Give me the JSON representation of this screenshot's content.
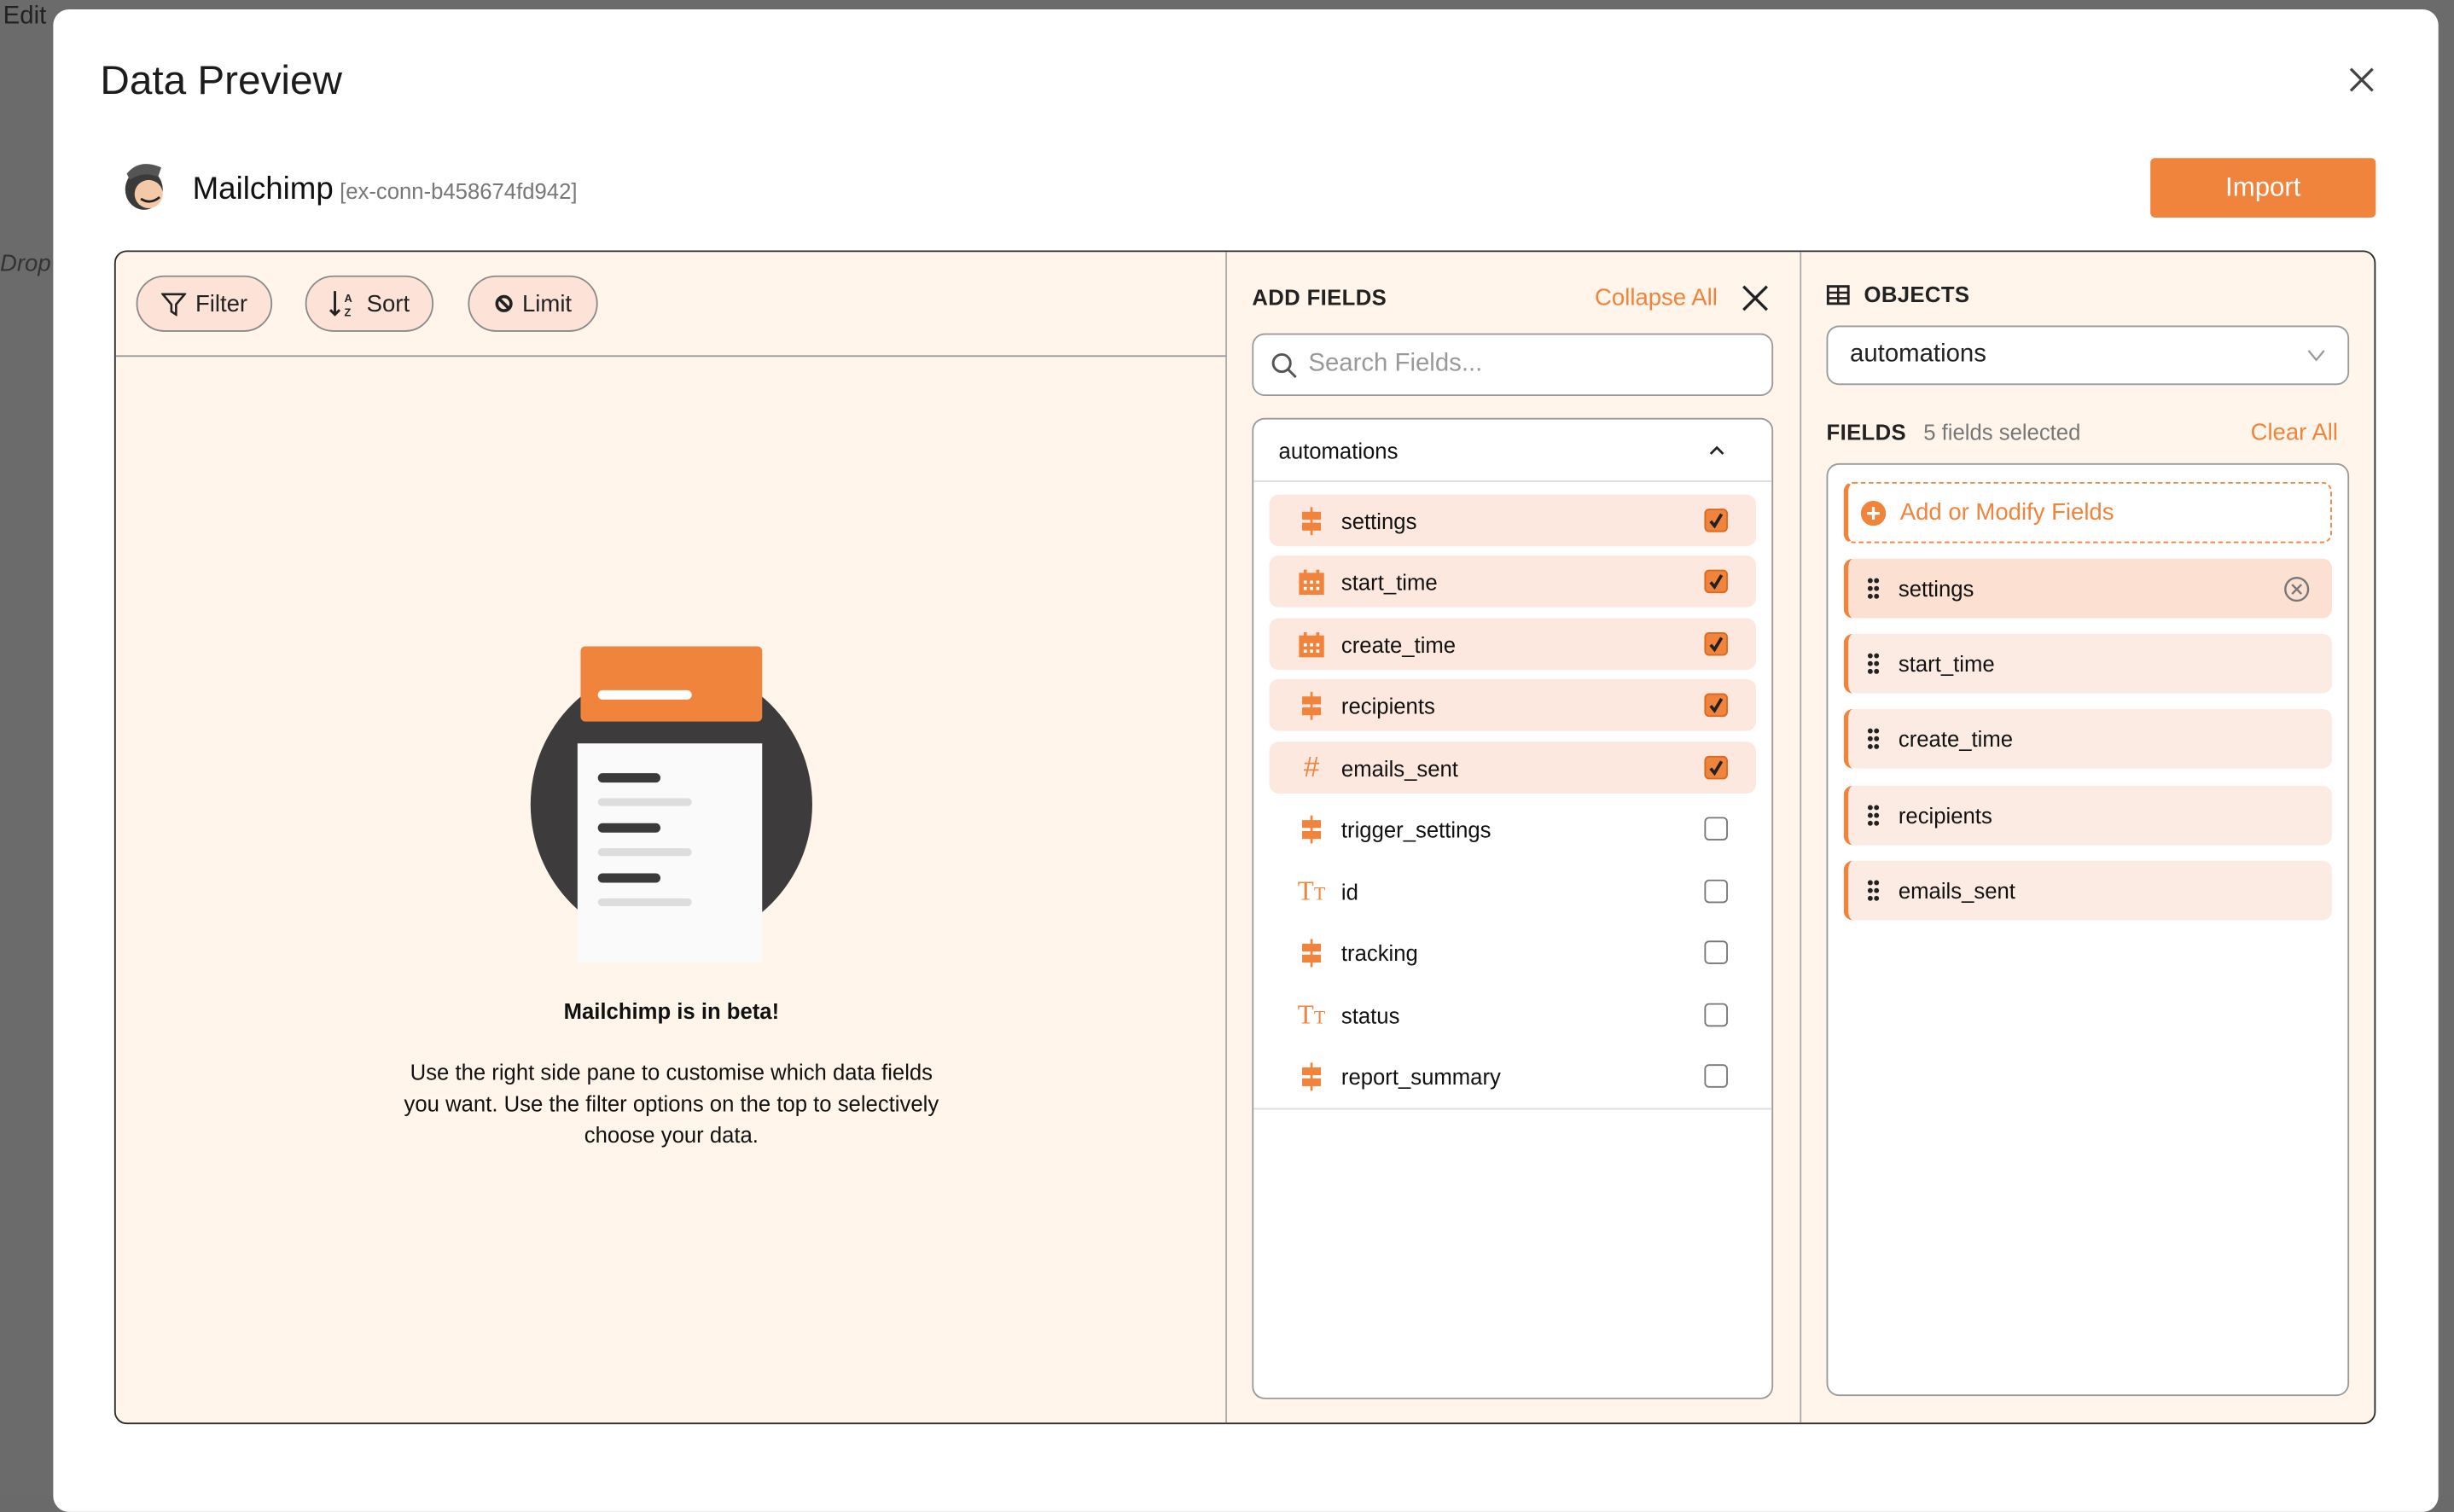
{
  "background": {
    "menu_edit": "Edit",
    "cell_text": "Drop"
  },
  "modal": {
    "title": "Data Preview",
    "connector": {
      "name": "Mailchimp",
      "id": "[ex-conn-b458674fd942]"
    },
    "import_label": "Import",
    "accent": "#f0843c"
  },
  "toolbar": {
    "filter": "Filter",
    "sort": "Sort",
    "limit": "Limit"
  },
  "empty_state": {
    "heading": "Mailchimp is in beta!",
    "lines": [
      "Use the right side pane to customise which data fields",
      "you want. Use the filter options on the top to selectively",
      "choose your data."
    ]
  },
  "add_fields": {
    "title": "ADD FIELDS",
    "collapse_all": "Collapse All",
    "search_placeholder": "Search Fields...",
    "group": "automations",
    "items": [
      {
        "label": "settings",
        "icon": "object-icon",
        "checked": true
      },
      {
        "label": "start_time",
        "icon": "calendar-icon",
        "checked": true
      },
      {
        "label": "create_time",
        "icon": "calendar-icon",
        "checked": true
      },
      {
        "label": "recipients",
        "icon": "object-icon",
        "checked": true
      },
      {
        "label": "emails_sent",
        "icon": "number-icon",
        "checked": true
      },
      {
        "label": "trigger_settings",
        "icon": "object-icon",
        "checked": false
      },
      {
        "label": "id",
        "icon": "text-icon",
        "checked": false
      },
      {
        "label": "tracking",
        "icon": "object-icon",
        "checked": false
      },
      {
        "label": "status",
        "icon": "text-icon",
        "checked": false
      },
      {
        "label": "report_summary",
        "icon": "object-icon",
        "checked": false
      }
    ]
  },
  "objects": {
    "title": "OBJECTS",
    "selected": "automations",
    "fields_label": "FIELDS",
    "fields_count": "5 fields selected",
    "clear_all": "Clear All",
    "add_modify": "Add or Modify Fields",
    "selected_fields": [
      "settings",
      "start_time",
      "create_time",
      "recipients",
      "emails_sent"
    ]
  }
}
